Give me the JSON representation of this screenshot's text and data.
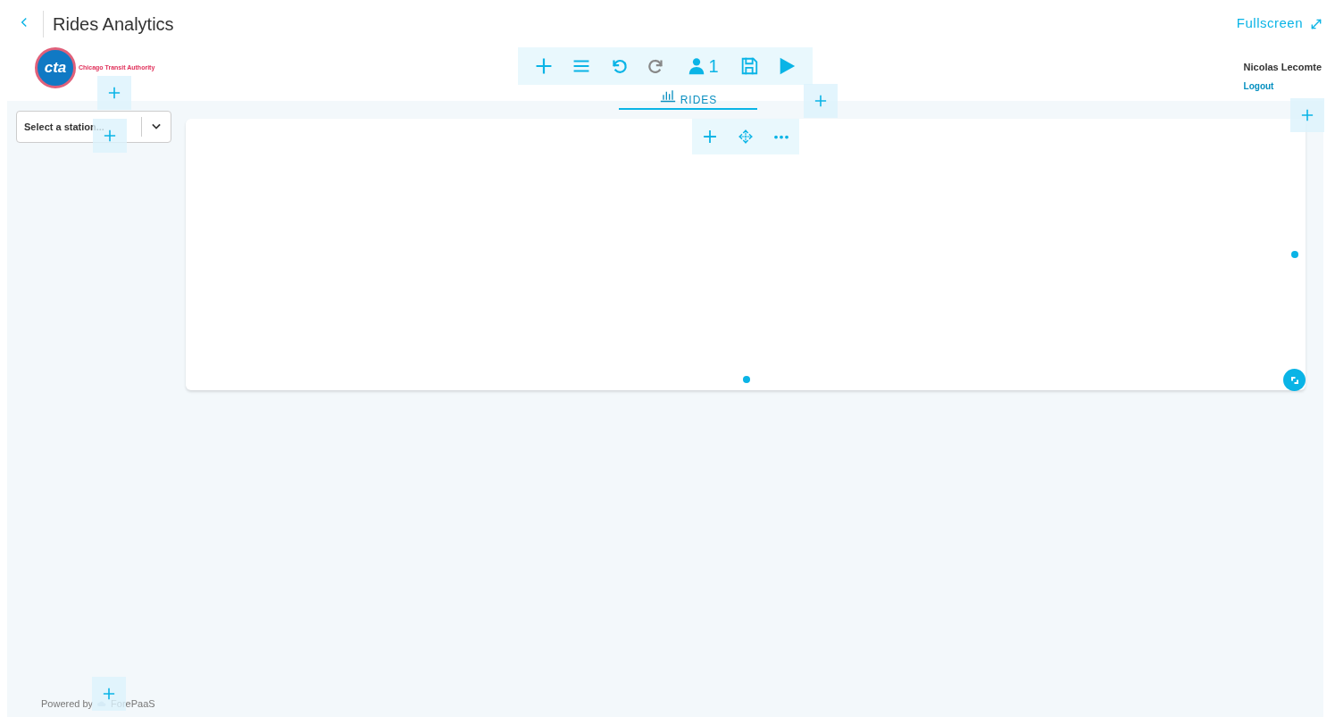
{
  "header": {
    "title": "Rides Analytics",
    "fullscreen": "Fullscreen"
  },
  "logo": {
    "mark": "cta",
    "name": "Chicago Transit Authority"
  },
  "toolbar": [
    {
      "kind": "add",
      "disabled": false
    },
    {
      "kind": "menu",
      "disabled": false
    },
    {
      "kind": "undo",
      "disabled": false
    },
    {
      "kind": "redo",
      "disabled": true
    },
    {
      "kind": "users",
      "disabled": false,
      "count": "1"
    },
    {
      "kind": "save",
      "disabled": false
    },
    {
      "kind": "play",
      "disabled": false
    }
  ],
  "user": {
    "name": "Nicolas Lecomte",
    "logout": "Logout"
  },
  "tabs": [
    {
      "label": "RIDES",
      "selected": true
    }
  ],
  "station_select": {
    "placeholder": "Select a station..."
  },
  "card_toolbar": [
    {
      "kind": "add"
    },
    {
      "kind": "move"
    },
    {
      "kind": "more"
    }
  ],
  "footer": {
    "powered_by": "Powered by",
    "brand": "ForePaaS"
  }
}
